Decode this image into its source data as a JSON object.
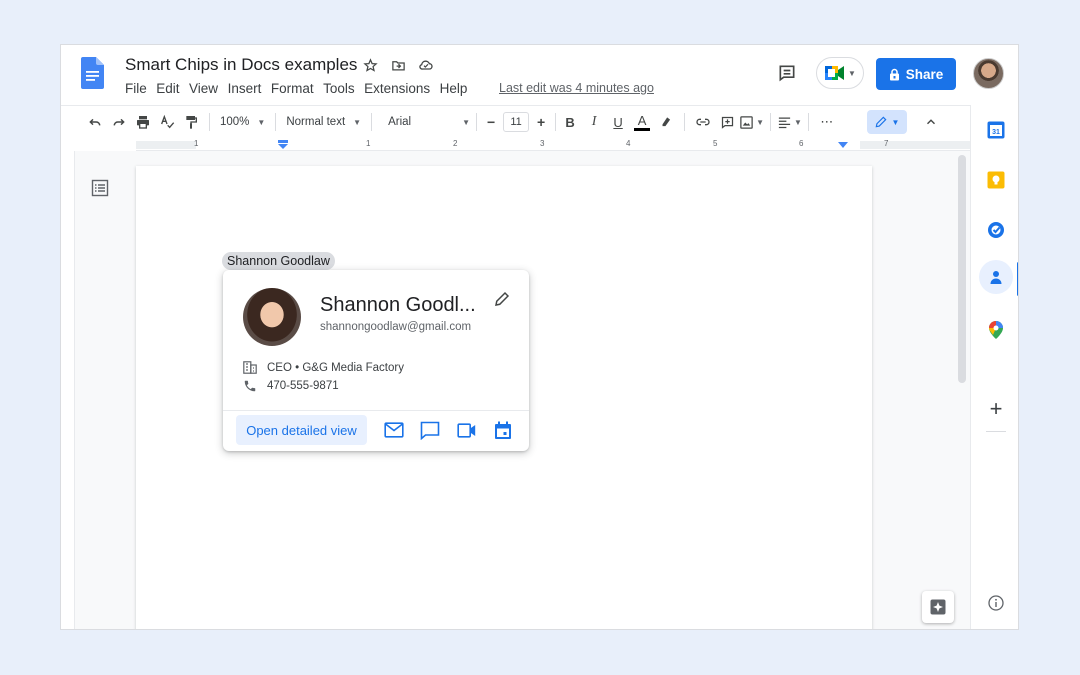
{
  "doc": {
    "title": "Smart Chips in Docs examples",
    "menu": [
      "File",
      "Edit",
      "View",
      "Insert",
      "Format",
      "Tools",
      "Extensions",
      "Help"
    ],
    "last_edit": "Last edit was 4 minutes ago",
    "share_label": "Share"
  },
  "toolbar": {
    "zoom": "100%",
    "style": "Normal text",
    "font": "Arial",
    "font_size": "11",
    "minus": "−",
    "plus": "+",
    "bold": "B",
    "italic": "I",
    "underline": "U",
    "text_color": "A",
    "more": "⋯"
  },
  "ruler": {
    "numbers": [
      "1",
      "1",
      "2",
      "3",
      "4",
      "5",
      "6",
      "7"
    ]
  },
  "chip": {
    "label": "Shannon Goodlaw"
  },
  "card": {
    "name": "Shannon Goodl...",
    "email": "shannongoodlaw@gmail.com",
    "role": "CEO • G&G Media Factory",
    "phone": "470-555-9871",
    "open_label": "Open detailed view"
  },
  "side_panel": {
    "calendar_day": "31",
    "add": "+"
  },
  "colors": {
    "accent": "#1a73e8",
    "doc_blue": "#4285f4",
    "background": "#e8effa"
  }
}
